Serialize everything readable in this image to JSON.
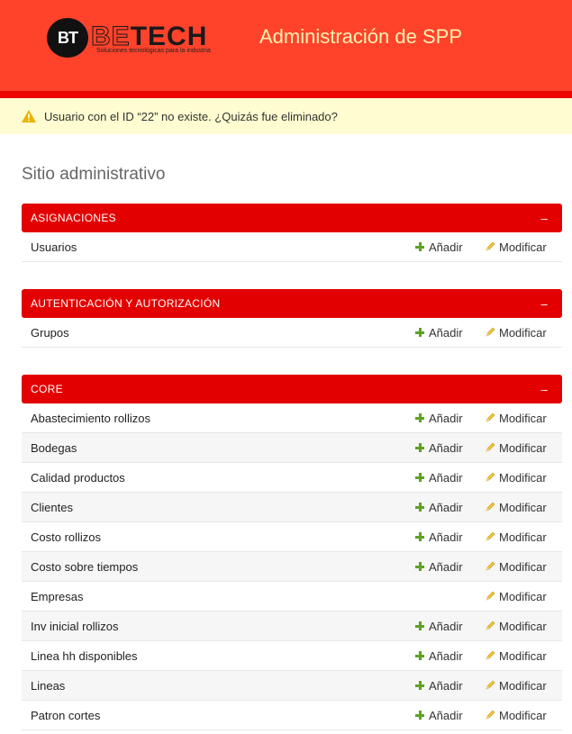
{
  "header": {
    "logo_mark": "BT",
    "logo_text_outline": "BE",
    "logo_text_solid": "TECH",
    "logo_tagline": "Soluciones tecnológicas para la industria",
    "site_title": "Administración de SPP",
    "colors": {
      "header_bg": "#ff432b",
      "accent_line": "#ec0700",
      "title": "#fff3b0"
    }
  },
  "message": {
    "icon": "warning-icon",
    "text": "Usuario con el ID “22” no existe. ¿Quizás fue eliminado?",
    "bg_color": "#fefcd0"
  },
  "page": {
    "title": "Sitio administrativo"
  },
  "labels": {
    "add": "Añadir",
    "change": "Modificar",
    "collapse": "–"
  },
  "apps": [
    {
      "name": "ASIGNACIONES",
      "models": [
        {
          "name": "Usuarios",
          "add": true
        }
      ]
    },
    {
      "name": "AUTENTICACIÓN Y AUTORIZACIÓN",
      "models": [
        {
          "name": "Grupos",
          "add": true
        }
      ]
    },
    {
      "name": "CORE",
      "models": [
        {
          "name": "Abastecimiento rollizos",
          "add": true
        },
        {
          "name": "Bodegas",
          "add": true
        },
        {
          "name": "Calidad productos",
          "add": true
        },
        {
          "name": "Clientes",
          "add": true
        },
        {
          "name": "Costo rollizos",
          "add": true
        },
        {
          "name": "Costo sobre tiempos",
          "add": true
        },
        {
          "name": "Empresas",
          "add": false
        },
        {
          "name": "Inv inicial rollizos",
          "add": true
        },
        {
          "name": "Linea hh disponibles",
          "add": true
        },
        {
          "name": "Lineas",
          "add": true
        },
        {
          "name": "Patron cortes",
          "add": true
        }
      ]
    }
  ]
}
